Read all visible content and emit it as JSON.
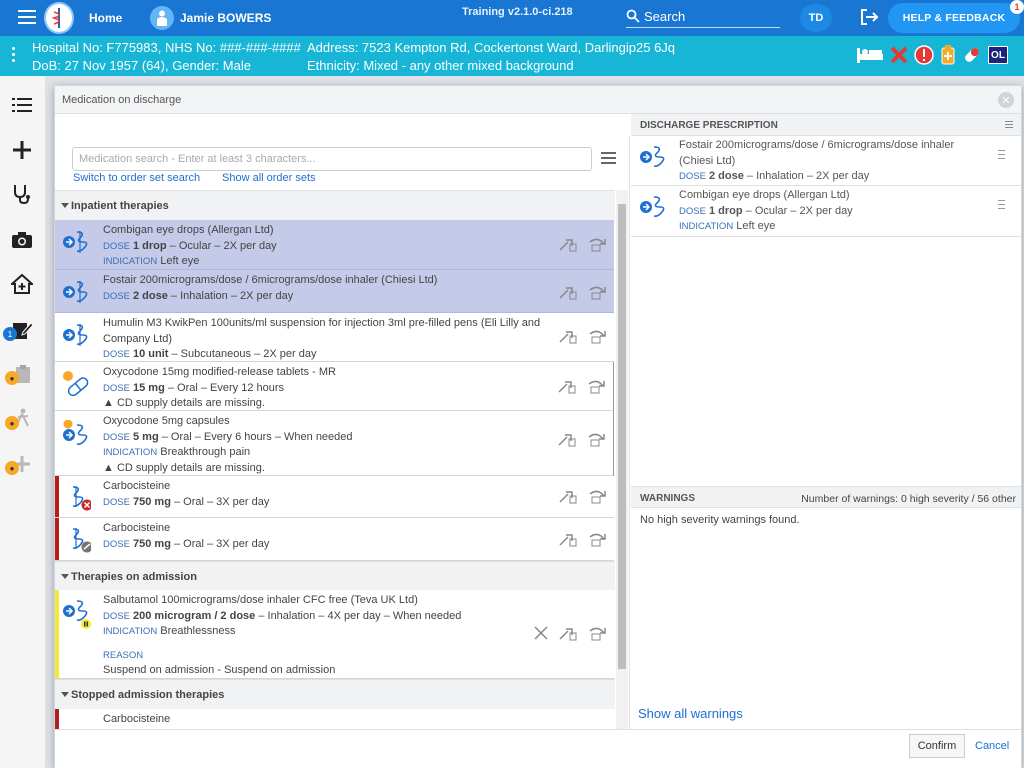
{
  "topbar": {
    "home": "Home",
    "user": "Jamie BOWERS",
    "version": "Training v2.1.0-ci.218",
    "search": "Search",
    "avatar": "TD",
    "help": "HELP & FEEDBACK",
    "help_badge": "1"
  },
  "patient": {
    "line1a": "Hospital No: F775983, NHS No: ###-###-####",
    "line1b": "Address: 7523 Kempton Rd, Cockertonst Ward, Darlingip25 6Jq",
    "line2a": "DoB: 27 Nov 1957 (64), Gender: Male",
    "line2b": "Ethnicity: Mixed - any other mixed background",
    "badge_ol": "OL"
  },
  "sidenav": {
    "badge_count": "1"
  },
  "modal": {
    "title": "Medication on discharge",
    "search_placeholder": "Medication search - Enter at least 3 characters...",
    "link_order_set": "Switch to order set search",
    "link_all_sets": "Show all order sets",
    "confirm": "Confirm",
    "cancel": "Cancel"
  },
  "sections": {
    "inpatient": "Inpatient therapies",
    "admission": "Therapies on admission",
    "stopped": "Stopped admission therapies"
  },
  "labels": {
    "dose": "DOSE",
    "indication": "INDICATION",
    "reason": "REASON"
  },
  "inpatient": [
    {
      "name": "Combigan eye drops (Allergan Ltd)",
      "dose": "1 drop",
      "route": " – Ocular – 2X per day",
      "indication": "Left eye"
    },
    {
      "name": "Fostair 200micrograms/dose / 6micrograms/dose inhaler (Chiesi Ltd)",
      "dose": "2 dose",
      "route": " – Inhalation – 2X per day"
    },
    {
      "name": "Humulin M3 KwikPen 100units/ml suspension for injection 3ml pre-filled pens (Eli Lilly and Company Ltd)",
      "dose": "10 unit",
      "route": " – Subcutaneous – 2X per day"
    },
    {
      "name": "Oxycodone 15mg modified-release tablets - MR",
      "dose": "15 mg",
      "route": " – Oral – Every 12 hours",
      "warning": "CD supply details are missing."
    },
    {
      "name": "Oxycodone 5mg capsules",
      "dose": "5 mg",
      "route": " – Oral – Every 6 hours – When needed",
      "indication": "Breakthrough pain",
      "warning": "CD supply details are missing."
    },
    {
      "name": "Carbocisteine",
      "dose": "750 mg",
      "route": " – Oral – 3X per day"
    },
    {
      "name": "Carbocisteine",
      "dose": "750 mg",
      "route": " – Oral – 3X per day"
    }
  ],
  "admission": [
    {
      "name": "Salbutamol 100micrograms/dose inhaler CFC free (Teva UK Ltd)",
      "dose": "200 microgram / 2 dose",
      "route": " – Inhalation – 4X per day – When needed",
      "indication": "Breathlessness",
      "reason": "Suspend on admission - Suspend on admission"
    }
  ],
  "stopped": [
    {
      "name": "Carbocisteine"
    }
  ],
  "prescription": {
    "title": "DISCHARGE PRESCRIPTION",
    "items": [
      {
        "name": "Fostair 200micrograms/dose / 6micrograms/dose inhaler (Chiesi Ltd)",
        "dose": "2 dose",
        "route": " – Inhalation – 2X per day"
      },
      {
        "name": "Combigan eye drops (Allergan Ltd)",
        "dose": "1 drop",
        "route": " – Ocular – 2X per day",
        "indication": "Left eye"
      }
    ]
  },
  "warnings": {
    "title": "WARNINGS",
    "summary": "Number of warnings: 0 high severity / 56 other",
    "message": "No high severity warnings found.",
    "show_all": "Show all warnings"
  },
  "colors": {
    "primary": "#1976d2",
    "patient_bar": "#17b6d6",
    "selected_row": "#c5cae9",
    "alert_red": "#b71c1c",
    "suspend_yellow": "#f4ea35"
  }
}
